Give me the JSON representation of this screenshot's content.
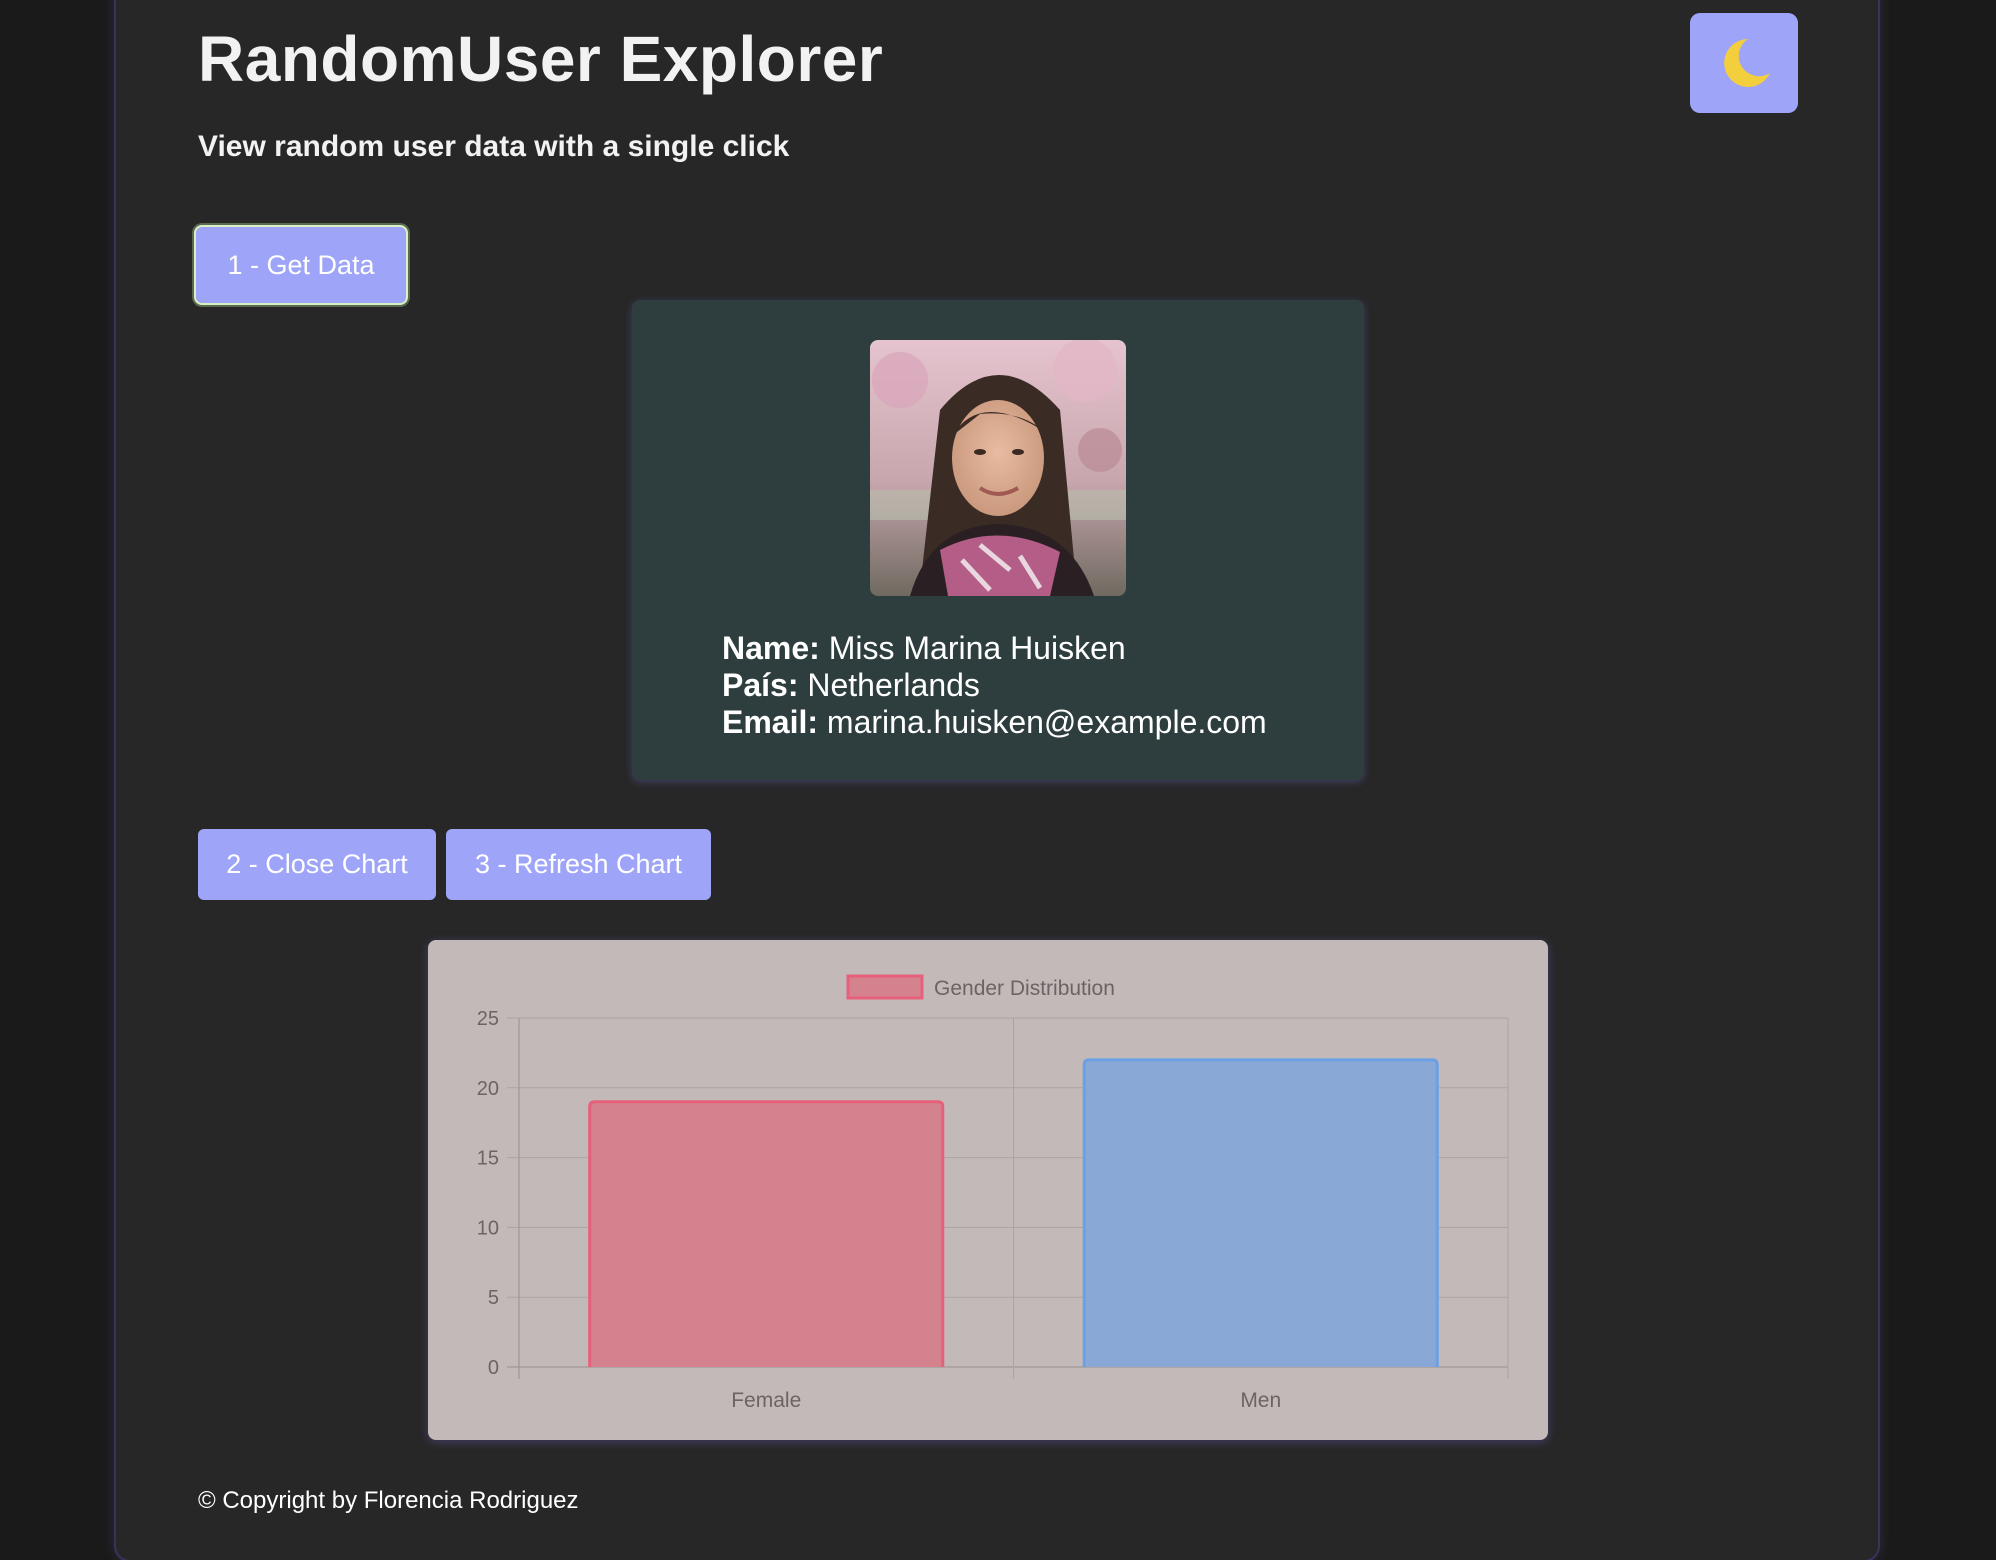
{
  "header": {
    "title": "RandomUser Explorer",
    "subtitle": "View random user data with a single click",
    "theme_toggle_icon": "crescent-moon-icon"
  },
  "actions": {
    "get_data_label": "1 - Get Data",
    "close_chart_label": "2 - Close Chart",
    "refresh_chart_label": "3 - Refresh Chart"
  },
  "user": {
    "name_label": "Name:",
    "name": "Miss Marina Huisken",
    "country_label": "País:",
    "country": "Netherlands",
    "email_label": "Email:",
    "email": "marina.huisken@example.com"
  },
  "chart_data": {
    "type": "bar",
    "categories": [
      "Female",
      "Men"
    ],
    "series": [
      {
        "name": "Gender Distribution",
        "values": [
          19,
          22
        ]
      }
    ],
    "ylim": [
      0,
      25
    ],
    "yticks": [
      0,
      5,
      10,
      15,
      20,
      25
    ],
    "grid": true,
    "legend": "top-center",
    "colors": {
      "fill": [
        "#d5828f",
        "#89a8d5"
      ],
      "stroke": [
        "#e7607a",
        "#6aa0e4"
      ]
    }
  },
  "footer": {
    "copyright": "© Copyright by Florencia Rodriguez"
  },
  "colors": {
    "page_bg": "#1a1a1a",
    "panel_bg": "#272727",
    "accent": "#9ea4f7",
    "card_bg": "#2e3e3e",
    "chart_bg": "#c4b9b9"
  }
}
